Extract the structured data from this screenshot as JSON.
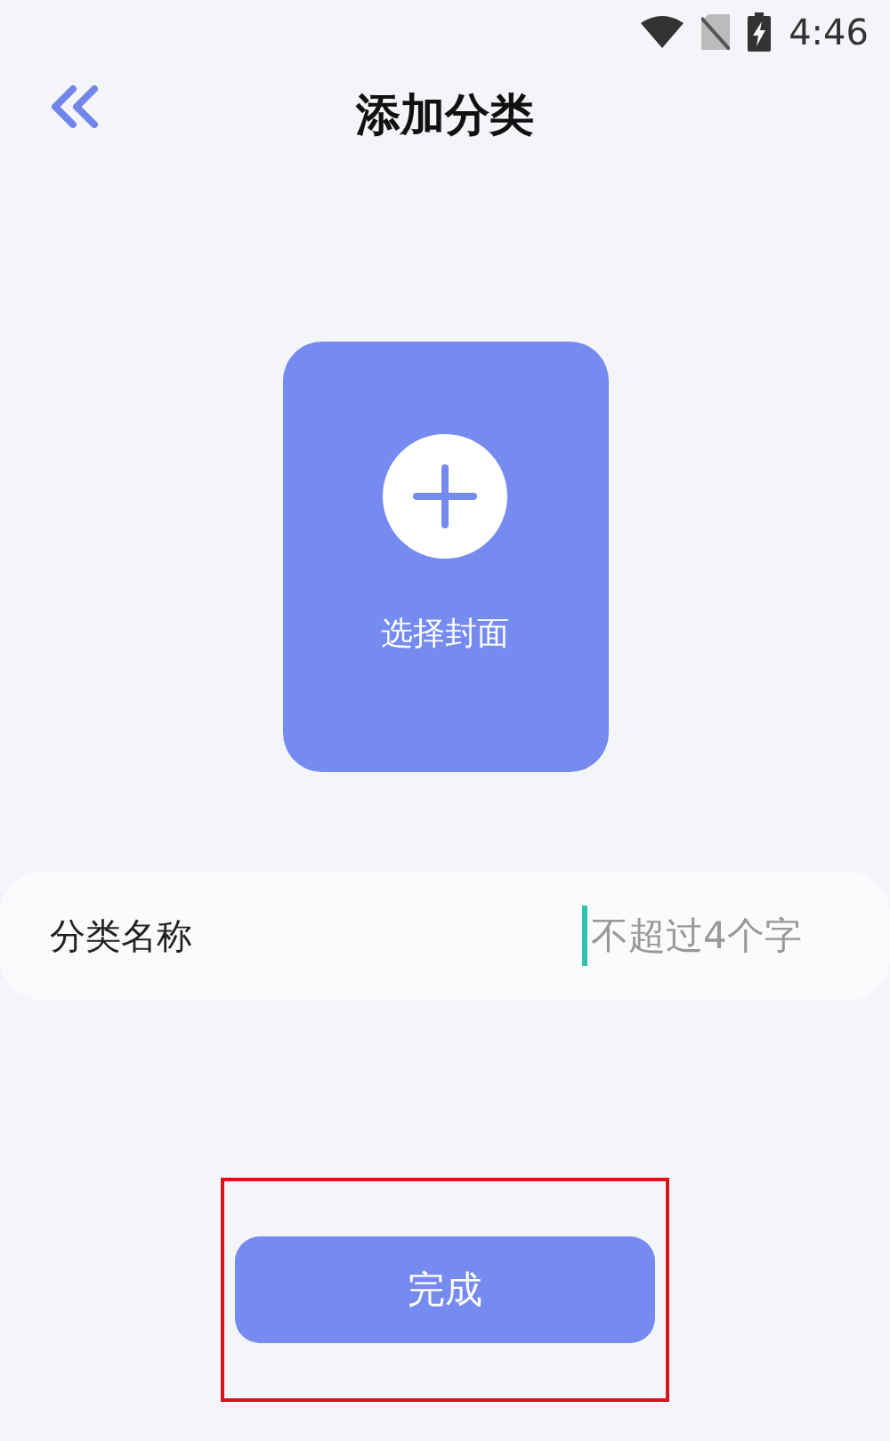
{
  "status_bar": {
    "time": "4:46"
  },
  "header": {
    "title": "添加分类"
  },
  "cover": {
    "label": "选择封面"
  },
  "name_field": {
    "label": "分类名称",
    "placeholder": "不超过4个字",
    "focused": true
  },
  "submit_button": {
    "label": "完成",
    "highlighted": true
  }
}
